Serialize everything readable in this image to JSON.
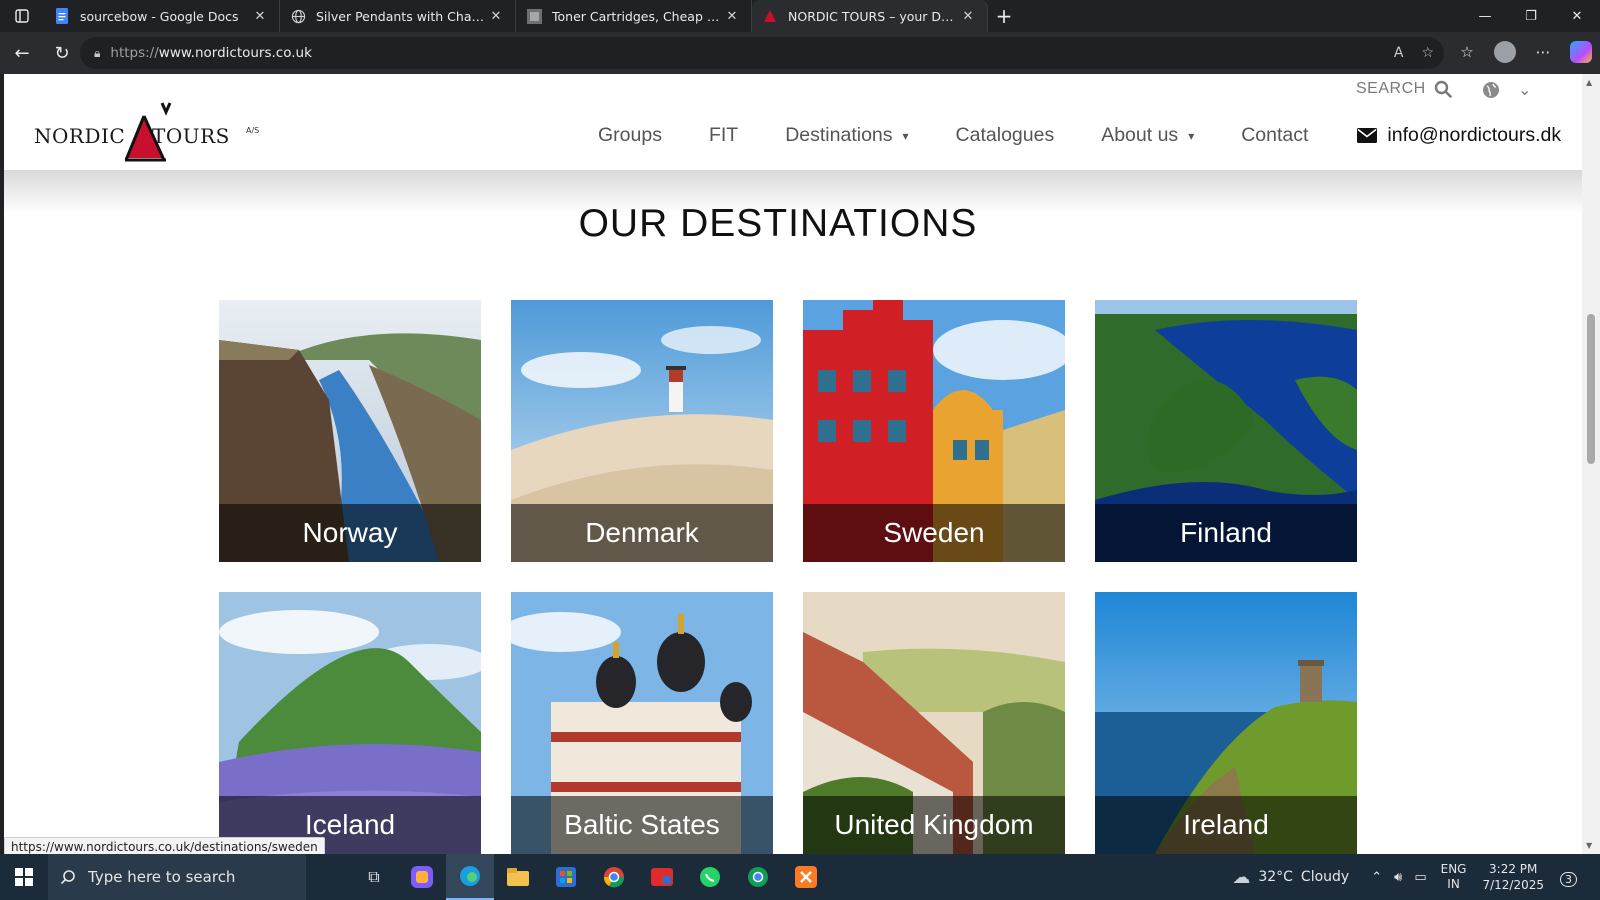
{
  "browser": {
    "tabs": [
      {
        "title": "sourcebow - Google Docs",
        "icon": "docs-icon",
        "active": false
      },
      {
        "title": "Silver Pendants with Chains Archi",
        "icon": "globe-icon",
        "active": false
      },
      {
        "title": "Toner Cartridges, Cheap Toner Ca",
        "icon": "site-icon",
        "active": false
      },
      {
        "title": "NORDIC TOURS – your DMC part",
        "icon": "nordic-icon",
        "active": true
      }
    ],
    "new_tab": "+",
    "url_prefix": "https://",
    "url_host": "www.nordictours.co.uk"
  },
  "site": {
    "logo": {
      "word1": "NORDIC",
      "word2": "TOURS",
      "suffix": "A/S"
    },
    "search_label": "SEARCH",
    "nav": [
      {
        "label": "Groups",
        "dropdown": false
      },
      {
        "label": "FIT",
        "dropdown": false
      },
      {
        "label": "Destinations",
        "dropdown": true
      },
      {
        "label": "Catalogues",
        "dropdown": false
      },
      {
        "label": "About us",
        "dropdown": true
      },
      {
        "label": "Contact",
        "dropdown": false
      }
    ],
    "email": "info@nordictours.dk",
    "section_title": "OUR DESTINATIONS",
    "destinations": [
      {
        "name": "Norway"
      },
      {
        "name": "Denmark"
      },
      {
        "name": "Sweden"
      },
      {
        "name": "Finland"
      },
      {
        "name": "Iceland"
      },
      {
        "name": "Baltic States"
      },
      {
        "name": "United Kingdom"
      },
      {
        "name": "Ireland"
      }
    ]
  },
  "status_url": "https://www.nordictours.co.uk/destinations/sweden",
  "taskbar": {
    "search_placeholder": "Type here to search",
    "weather_temp": "32°C",
    "weather_text": "Cloudy",
    "lang_top": "ENG",
    "lang_bottom": "IN",
    "time": "3:22 PM",
    "date": "7/12/2025",
    "notifications": "3"
  },
  "colors": {
    "accent_red": "#c8102e",
    "taskbar": "#1c2b3a",
    "caption_overlay": "rgba(0,0,0,0.55)"
  }
}
